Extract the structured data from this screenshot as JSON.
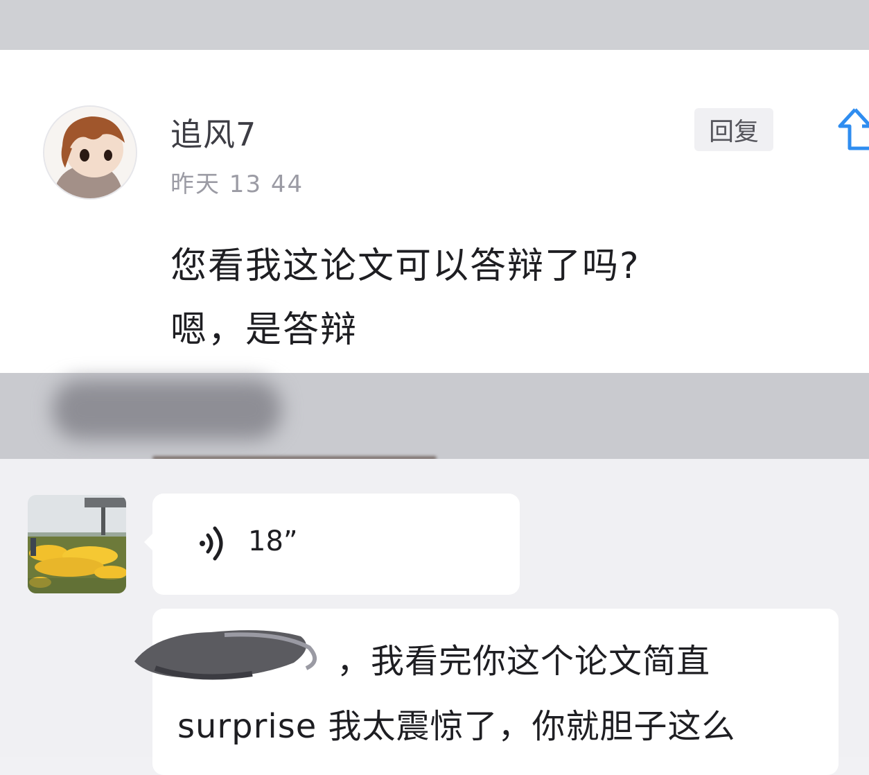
{
  "comment": {
    "username": "追风7",
    "timestamp": "昨天 13 44",
    "reply_label": "回复",
    "text_lines": [
      "您看我这论文可以答辩了吗?",
      "嗯，是答辩"
    ]
  },
  "chat": {
    "voice_duration": "18”",
    "message_line1": "，我看完你这个论文简直",
    "message_line2": "surprise 我太震惊了，你就胆子这么"
  },
  "icons": {
    "share": "share-up-arrow-icon",
    "voice": "voice-wave-icon"
  }
}
